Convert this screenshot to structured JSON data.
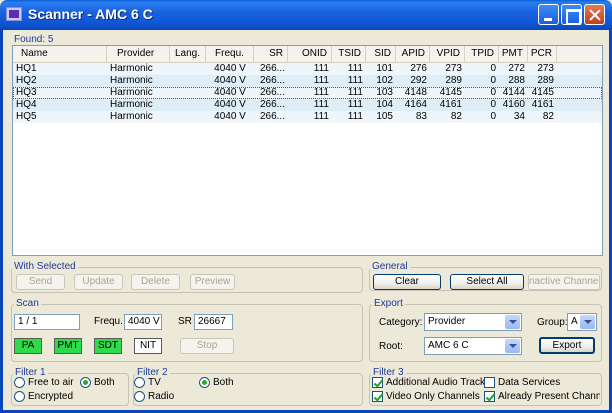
{
  "window": {
    "title": "Scanner - AMC 6 C"
  },
  "found_label": "Found: 5",
  "table": {
    "columns": [
      "Name",
      "Provider",
      "Lang.",
      "Frequ.",
      "SR",
      "ONID",
      "TSID",
      "SID",
      "APID",
      "VPID",
      "TPID",
      "PMT",
      "PCR"
    ],
    "rows": [
      {
        "name": "HQ1",
        "provider": "Harmonic",
        "lang": "",
        "freq": "4040 V",
        "sr": "266...",
        "onid": "111",
        "tsid": "111",
        "sid": "101",
        "apid": "276",
        "vpid": "273",
        "tpid": "0",
        "pmt": "272",
        "pcr": "273"
      },
      {
        "name": "HQ2",
        "provider": "Harmonic",
        "lang": "",
        "freq": "4040 V",
        "sr": "266...",
        "onid": "111",
        "tsid": "111",
        "sid": "102",
        "apid": "292",
        "vpid": "289",
        "tpid": "0",
        "pmt": "288",
        "pcr": "289"
      },
      {
        "name": "HQ3",
        "provider": "Harmonic",
        "lang": "",
        "freq": "4040 V",
        "sr": "266...",
        "onid": "111",
        "tsid": "111",
        "sid": "103",
        "apid": "4148",
        "vpid": "4145",
        "tpid": "0",
        "pmt": "4144",
        "pcr": "4145"
      },
      {
        "name": "HQ4",
        "provider": "Harmonic",
        "lang": "",
        "freq": "4040 V",
        "sr": "266...",
        "onid": "111",
        "tsid": "111",
        "sid": "104",
        "apid": "4164",
        "vpid": "4161",
        "tpid": "0",
        "pmt": "4160",
        "pcr": "4161"
      },
      {
        "name": "HQ5",
        "provider": "Harmonic",
        "lang": "",
        "freq": "4040 V",
        "sr": "266...",
        "onid": "111",
        "tsid": "111",
        "sid": "105",
        "apid": "83",
        "vpid": "82",
        "tpid": "0",
        "pmt": "34",
        "pcr": "82"
      }
    ]
  },
  "with_selected": {
    "title": "With Selected",
    "send": "Send",
    "update": "Update",
    "delete": "Delete",
    "preview": "Preview"
  },
  "general": {
    "title": "General",
    "clear": "Clear",
    "select_all": "Select All",
    "inactive_channels": "nactive Channels"
  },
  "scan": {
    "title": "Scan",
    "progress": "1 / 1",
    "freq_label": "Frequ.",
    "freq_value": "4040 V",
    "sr_label": "SR",
    "sr_value": "26667",
    "pa": "PA",
    "pmt": "PMT",
    "sdt": "SDT",
    "nit": "NIT",
    "stop": "Stop"
  },
  "export": {
    "title": "Export",
    "category_label": "Category:",
    "category_value": "Provider",
    "group_label": "Group:",
    "group_value": "A",
    "root_label": "Root:",
    "root_value": "AMC 6 C",
    "export_button": "Export"
  },
  "filter1": {
    "title": "Filter 1",
    "free_to_air": "Free to air",
    "both": "Both",
    "encrypted": "Encrypted",
    "selected": "both"
  },
  "filter2": {
    "title": "Filter 2",
    "tv": "TV",
    "both": "Both",
    "radio": "Radio",
    "selected": "both"
  },
  "filter3": {
    "title": "Filter 3",
    "additional_audio_track": "Additional Audio Track",
    "data_services": "Data Services",
    "video_only_channels": "Video Only Channels",
    "already_present_channels": "Already Present Channe",
    "checked": {
      "additional_audio_track": true,
      "data_services": false,
      "video_only_channels": true,
      "already_present_channels": true
    }
  },
  "colors": {
    "titlebar": "#0d55d4",
    "green_button": "#2edc4a",
    "group_title": "#1f3a96",
    "row_alt": "#dfeef6"
  }
}
